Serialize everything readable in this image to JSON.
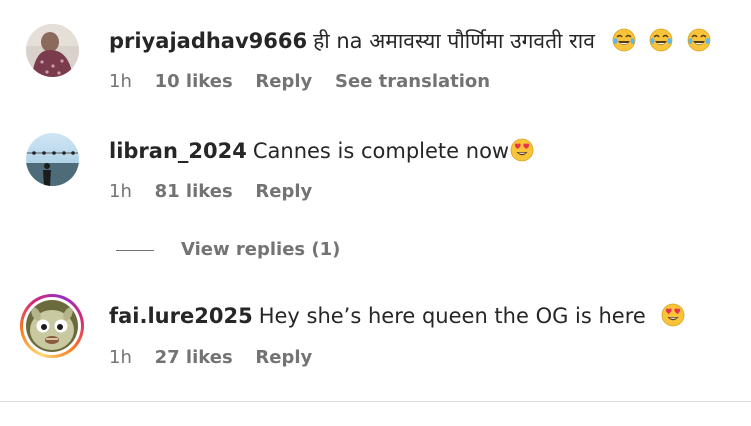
{
  "comments": [
    {
      "username": "priyajadhav9666",
      "text": "ही na अमावस्या पौर्णिमा उगवती राव",
      "emojis": [
        "face-with-tears-of-joy-icon",
        "face-with-tears-of-joy-icon",
        "face-with-tears-of-joy-icon"
      ],
      "time": "1h",
      "likes": "10 likes",
      "reply_label": "Reply",
      "translation_label": "See translation"
    },
    {
      "username": "libran_2024",
      "text": "Cannes is complete now",
      "emojis": [
        "heart-eyes-face-icon"
      ],
      "time": "1h",
      "likes": "81 likes",
      "reply_label": "Reply",
      "view_replies_label": "View replies (1)"
    },
    {
      "username": "fai.lure2025",
      "text": "Hey she’s here queen the OG is here",
      "emojis": [
        "heart-eyes-face-icon"
      ],
      "time": "1h",
      "likes": "27 likes",
      "reply_label": "Reply"
    }
  ],
  "colors": {
    "text_primary": "#262626",
    "text_secondary": "#737373",
    "divider": "#dbdbdb",
    "story_ring": [
      "#feda75",
      "#fa7e1e",
      "#d62976",
      "#962fbf"
    ]
  }
}
